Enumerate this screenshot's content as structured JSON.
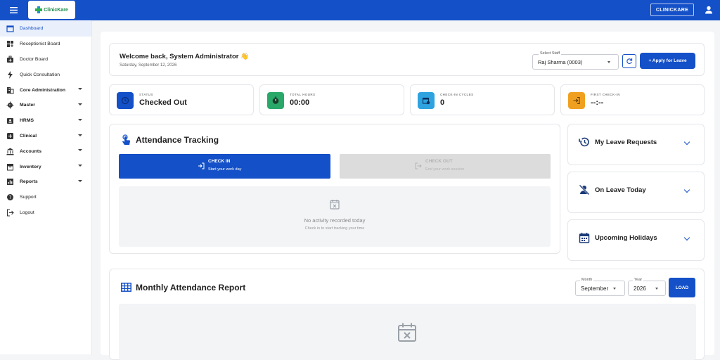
{
  "topbar": {
    "brand_logo_text": "ClinicKare",
    "clinic_button": "CLINICKARE"
  },
  "sidebar": {
    "items": [
      {
        "label": "Dashboard",
        "icon": "calendar-icon"
      },
      {
        "label": "Receptionist Board",
        "icon": "grid-plus-icon"
      },
      {
        "label": "Doctor Board",
        "icon": "medical-bag-icon"
      },
      {
        "label": "Quick Consultation",
        "icon": "lightning-icon"
      },
      {
        "label": "Core Administration",
        "icon": "building-icon"
      },
      {
        "label": "Master",
        "icon": "gear-icon"
      },
      {
        "label": "HRMS",
        "icon": "id-badge-icon"
      },
      {
        "label": "Clinical",
        "icon": "medical-cross-icon"
      },
      {
        "label": "Accounts",
        "icon": "bank-icon"
      },
      {
        "label": "Inventory",
        "icon": "inventory-box-icon"
      },
      {
        "label": "Reports",
        "icon": "report-icon"
      },
      {
        "label": "Support",
        "icon": "help-icon"
      },
      {
        "label": "Logout",
        "icon": "logout-icon"
      }
    ]
  },
  "welcome": {
    "title": "Welcome back, System Administrator 👋",
    "date": "Saturday, September 12, 2026",
    "staff_label": "Select Staff",
    "staff_value": "Raj Sharma (0003)",
    "apply_label": "+ Apply for Leave"
  },
  "stats": [
    {
      "label": "STATUS",
      "value": "Checked Out",
      "color": "#1450c8",
      "icon": "clock-icon"
    },
    {
      "label": "TOTAL HOURS",
      "value": "00:00",
      "color": "#2aa86a",
      "icon": "timer-icon"
    },
    {
      "label": "CHECK-IN CYCLES",
      "value": "0",
      "color": "#2ea3e0",
      "icon": "calendar-cycle-icon"
    },
    {
      "label": "FIRST CHECK-IN",
      "value": "--:--",
      "color": "#f0a020",
      "icon": "login-icon"
    }
  ],
  "attendance": {
    "title": "Attendance Tracking",
    "checkin_label": "CHECK IN",
    "checkin_sub": "Start your work day",
    "checkout_label": "CHECK OUT",
    "checkout_sub": "End your work session",
    "empty_title": "No activity recorded today",
    "empty_sub": "Check in to start tracking your time"
  },
  "side_cards": [
    {
      "title": "My Leave Requests",
      "icon": "history-icon"
    },
    {
      "title": "On Leave Today",
      "icon": "person-off-icon"
    },
    {
      "title": "Upcoming Holidays",
      "icon": "calendar-icon"
    }
  ],
  "monthly": {
    "title": "Monthly Attendance Report",
    "month_label": "Month",
    "month_value": "September",
    "year_label": "Year",
    "year_value": "2026",
    "load_label": "LOAD"
  },
  "colors": {
    "primary": "#1450c8"
  }
}
